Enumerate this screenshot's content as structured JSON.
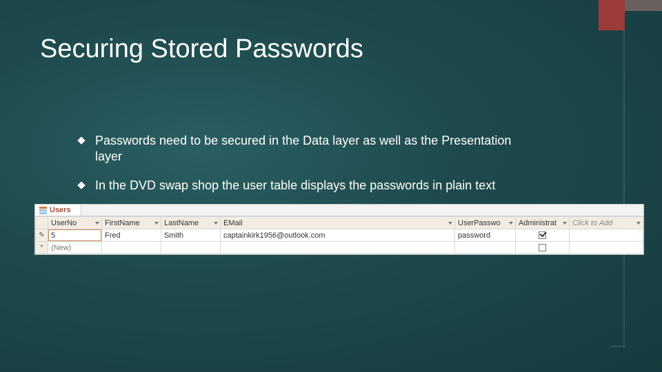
{
  "title": "Securing Stored Passwords",
  "bullets": [
    "Passwords need to be secured in the Data layer as well as the Presentation layer",
    "In the DVD swap shop the user table displays the passwords in plain text"
  ],
  "datasheet": {
    "tab_label": "Users",
    "columns": {
      "user_no": "UserNo",
      "first_name": "FirstName",
      "last_name": "LastName",
      "email": "EMail",
      "user_password": "UserPasswo",
      "administrator": "Administrat",
      "click_to_add": "Click to Add"
    },
    "rows": [
      {
        "selector": "✎",
        "user_no": "5",
        "first_name": "Fred",
        "last_name": "Smith",
        "email": "captainkirk1956@outlook.com",
        "user_password": "password",
        "administrator_checked": true
      }
    ],
    "new_row": {
      "selector": "*",
      "user_no": "(New)",
      "administrator_checked": false
    }
  }
}
